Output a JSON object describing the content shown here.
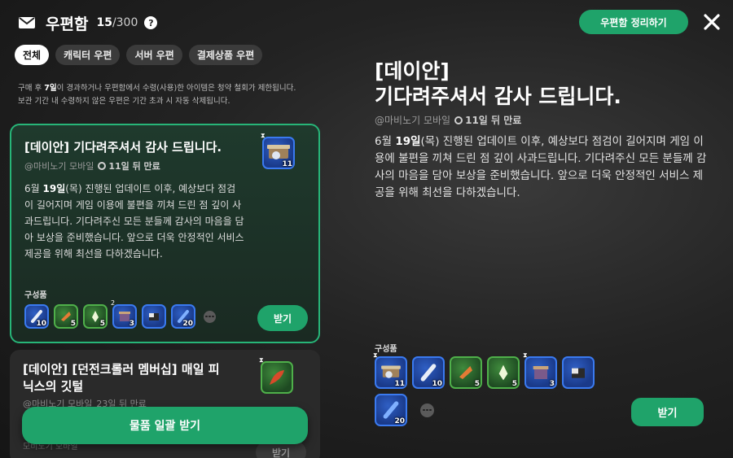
{
  "header": {
    "title": "우편함",
    "count_current": "15",
    "count_total": "/300",
    "help_glyph": "?",
    "organize_label": "우편함 정리하기"
  },
  "tabs": [
    {
      "label": "전체",
      "active": true
    },
    {
      "label": "캐릭터 우편",
      "active": false
    },
    {
      "label": "서버 우편",
      "active": false
    },
    {
      "label": "결제상품 우편",
      "active": false
    }
  ],
  "notice": {
    "line1_pre": "구매 후 ",
    "line1_days": "7일",
    "line1_post": "이 경과하거나 우편함에서 수령(사용)한 아이템은 청약 철회가 제한됩니다.",
    "line2": "보관 기간 내 수령하지 않은 우편은 기간 초과 시 자동 삭제됩니다."
  },
  "mails": [
    {
      "title": "[데이안] 기다려주셔서 감사 드립니다.",
      "sender": "@마비노기 모바일",
      "expiry": "11일 뒤 만료",
      "body_pre": "6월 ",
      "body_day": "19일",
      "body_post": "(목) 진행된 업데이트 이후, 예상보다 점검이 길어지며 게임 이용에 불편을 끼쳐 드린 점 깊이 사과드립니다.  기다려주신 모든 분들께 감사의 마음을 담아 보상을 준비했습니다. 앞으로 더욱 안정적인 서비스 제공을 위해 최선을 다하겠습니다.",
      "thumb_qty": "11",
      "composition_label": "구성품",
      "items": [
        {
          "icon": "scroll-icon",
          "qty": "10",
          "tint": "blue"
        },
        {
          "icon": "bread-icon",
          "qty": "5",
          "tint": "green"
        },
        {
          "icon": "potion-icon",
          "qty": "5",
          "tint": "green"
        },
        {
          "icon": "box-icon",
          "qty": "3",
          "tint": "blue",
          "hourglass": "2"
        },
        {
          "icon": "chest-icon",
          "qty": "",
          "tint": "blue"
        },
        {
          "icon": "vial-icon",
          "qty": "20",
          "tint": "blue"
        }
      ],
      "receive_label": "받기"
    },
    {
      "title": "[데이안] [던전크롤러 멤버십] 매일 피닉스의 깃털",
      "sender": "@마비노기 모바일",
      "expiry": "23일 뒤 만료",
      "footer_partial": "모비노기 모바일",
      "receive_label": "받기"
    }
  ],
  "bulk_receive_label": "물품 일괄 받기",
  "detail": {
    "title_line1": "[데이안]",
    "title_line2": "기다려주셔서 감사 드립니다.",
    "sender": "@마비노기 모바일",
    "expiry": "11일 뒤 만료",
    "body_pre": "6월 ",
    "body_day": "19일",
    "body_post": "(목) 진행된 업데이트 이후, 예상보다 점검이 길어지며 게임 이용에 불편을 끼쳐 드린 점 깊이 사과드립니다.  기다려주신 모든 분들께 감사의 마음을 담아 보상을 준비했습니다. 앞으로 더욱 안정적인 서비스 제공을 위해 최선을 다하겠습니다.",
    "composition_label": "구성품",
    "items": [
      {
        "icon": "crate-icon",
        "qty": "11",
        "tint": "blue",
        "hourglass": "⧗"
      },
      {
        "icon": "scroll-icon",
        "qty": "10",
        "tint": "blue"
      },
      {
        "icon": "bread-icon",
        "qty": "5",
        "tint": "green"
      },
      {
        "icon": "potion-icon",
        "qty": "5",
        "tint": "green"
      },
      {
        "icon": "box-icon",
        "qty": "3",
        "tint": "blue",
        "hourglass": "⧗"
      },
      {
        "icon": "chest-icon",
        "qty": "",
        "tint": "blue"
      },
      {
        "icon": "vial-icon",
        "qty": "20",
        "tint": "blue"
      }
    ],
    "receive_label": "받기"
  },
  "colors": {
    "accent": "#1fa36a",
    "selected_border": "#27b578"
  }
}
